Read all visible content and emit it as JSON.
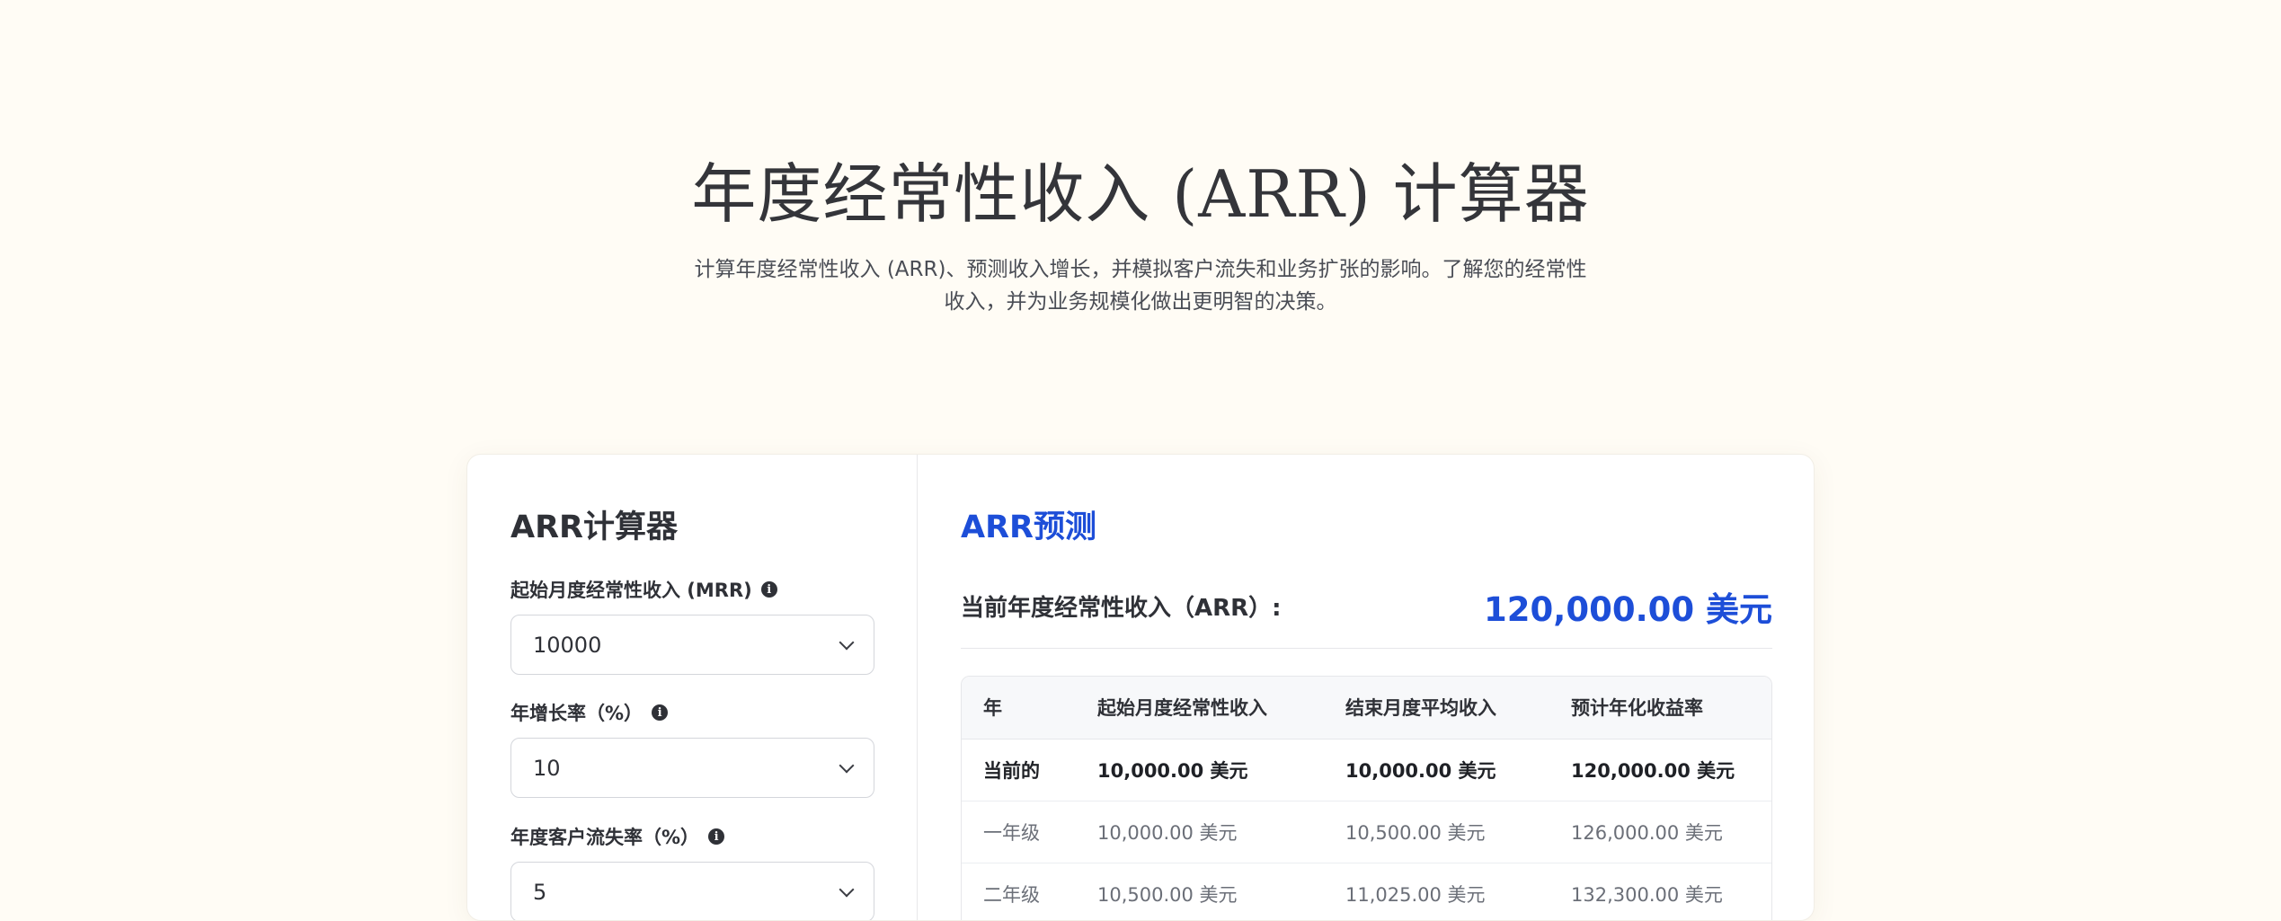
{
  "hero": {
    "title": "年度经常性收入 (ARR) 计算器",
    "description": "计算年度经常性收入 (ARR)、预测收入增长，并模拟客户流失和业务扩张的影响。了解您的经常性收入，并为业务规模化做出更明智的决策。"
  },
  "calculator": {
    "title": "ARR计算器",
    "fields": [
      {
        "label": "起始月度经常性收入 (MRR)",
        "value": "10000"
      },
      {
        "label": "年增长率（%）",
        "value": "10"
      },
      {
        "label": "年度客户流失率（%）",
        "value": "5"
      }
    ]
  },
  "projection": {
    "title": "ARR预测",
    "current_label": "当前年度经常性收入（ARR）:",
    "current_value": "120,000.00 美元",
    "headers": [
      "年",
      "起始月度经常性收入",
      "结束月度平均收入",
      "预计年化收益率"
    ],
    "rows": [
      {
        "year": "当前的",
        "start": "10,000.00 美元",
        "end": "10,000.00 美元",
        "arr": "120,000.00 美元",
        "current": true
      },
      {
        "year": "一年级",
        "start": "10,000.00 美元",
        "end": "10,500.00 美元",
        "arr": "126,000.00 美元",
        "current": false
      },
      {
        "year": "二年级",
        "start": "10,500.00 美元",
        "end": "11,025.00 美元",
        "arr": "132,300.00 美元",
        "current": false
      }
    ]
  },
  "colors": {
    "accent": "#1d4ed8",
    "background": "#fffcf5"
  }
}
